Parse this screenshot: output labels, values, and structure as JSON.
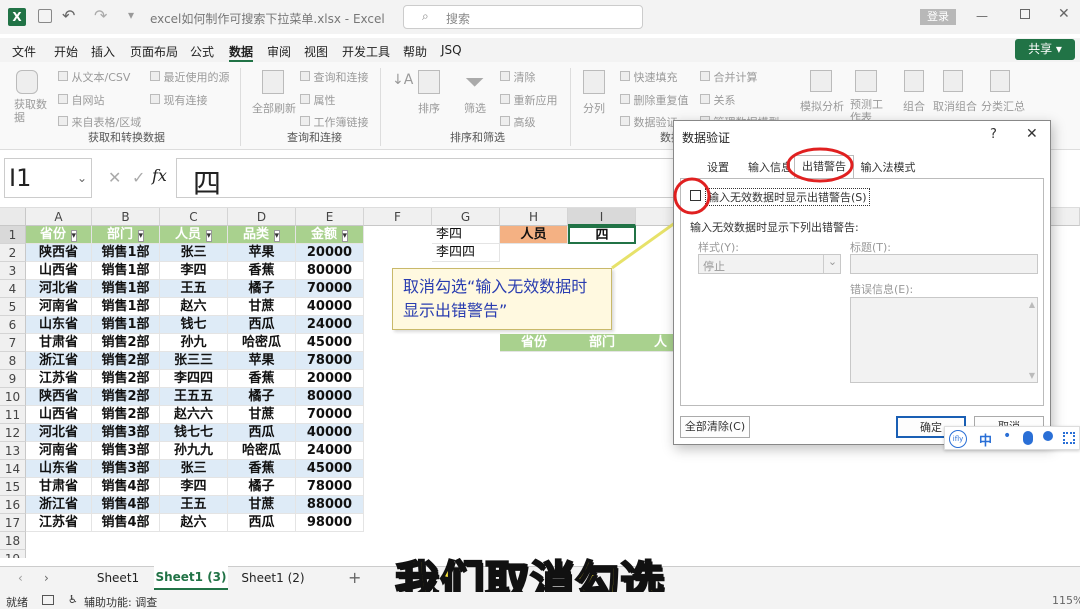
{
  "title": {
    "filename": "excel如何制作可搜索下拉菜单.xlsx - Excel",
    "search_placeholder": "搜索",
    "login": "登录"
  },
  "menu": {
    "items": [
      "文件",
      "开始",
      "插入",
      "页面布局",
      "公式",
      "数据",
      "审阅",
      "视图",
      "开发工具",
      "帮助",
      "JSQ"
    ],
    "share": "共享"
  },
  "ribbon": {
    "g1": {
      "big": "获取数据",
      "items": [
        "从文本/CSV",
        "自网站",
        "来自表格/区域",
        "最近使用的源",
        "现有连接"
      ],
      "label": "获取和转换数据"
    },
    "g2": {
      "big": "全部刷新",
      "items": [
        "查询和连接",
        "属性",
        "工作簿链接"
      ],
      "label": "查询和连接"
    },
    "g3": {
      "sort": "排序",
      "filter": "筛选",
      "items": [
        "清除",
        "重新应用",
        "高级"
      ],
      "label": "排序和筛选"
    },
    "g4": {
      "big": "分列",
      "items": [
        "快速填充",
        "删除重复值",
        "数据验证",
        "合并计算",
        "关系",
        "管理数据模型"
      ],
      "label": "数据"
    },
    "g5": {
      "items": [
        "模拟分析",
        "预测工作表"
      ]
    },
    "g6": {
      "items": [
        "组合",
        "取消组合",
        "分类汇总"
      ]
    }
  },
  "formula": {
    "namebox": "I1",
    "fx": "fx",
    "value": "四"
  },
  "grid": {
    "columns": [
      "A",
      "B",
      "C",
      "D",
      "E",
      "F",
      "G",
      "H",
      "I"
    ],
    "headers": [
      "省份",
      "部门",
      "人员",
      "品类",
      "金额"
    ],
    "rows": [
      [
        "陕西省",
        "销售1部",
        "张三",
        "苹果",
        "20000"
      ],
      [
        "山西省",
        "销售1部",
        "李四",
        "香蕉",
        "80000"
      ],
      [
        "河北省",
        "销售1部",
        "王五",
        "橘子",
        "70000"
      ],
      [
        "河南省",
        "销售1部",
        "赵六",
        "甘蔗",
        "40000"
      ],
      [
        "山东省",
        "销售1部",
        "钱七",
        "西瓜",
        "24000"
      ],
      [
        "甘肃省",
        "销售2部",
        "孙九",
        "哈密瓜",
        "45000"
      ],
      [
        "浙江省",
        "销售2部",
        "张三三",
        "苹果",
        "78000"
      ],
      [
        "江苏省",
        "销售2部",
        "李四四",
        "香蕉",
        "20000"
      ],
      [
        "陕西省",
        "销售2部",
        "王五五",
        "橘子",
        "80000"
      ],
      [
        "山西省",
        "销售2部",
        "赵六六",
        "甘蔗",
        "70000"
      ],
      [
        "河北省",
        "销售3部",
        "钱七七",
        "西瓜",
        "40000"
      ],
      [
        "河南省",
        "销售3部",
        "孙九九",
        "哈密瓜",
        "24000"
      ],
      [
        "山东省",
        "销售3部",
        "张三",
        "香蕉",
        "45000"
      ],
      [
        "甘肃省",
        "销售4部",
        "李四",
        "橘子",
        "78000"
      ],
      [
        "浙江省",
        "销售4部",
        "王五",
        "甘蔗",
        "88000"
      ],
      [
        "江苏省",
        "销售4部",
        "赵六",
        "西瓜",
        "98000"
      ]
    ],
    "rownums": [
      "1",
      "2",
      "3",
      "4",
      "5",
      "6",
      "7",
      "8",
      "9",
      "10",
      "11",
      "12",
      "13",
      "14",
      "15",
      "16",
      "17",
      "18",
      "19"
    ],
    "g1": "李四",
    "g2": "李四四",
    "h1": "人员",
    "i1": "四",
    "h7": [
      "省份",
      "部门",
      "人"
    ]
  },
  "callout": "取消勾选“输入无效数据时显示出错警告”",
  "subtitle": "我们取消勾选",
  "dialog": {
    "title": "数据验证",
    "help": "?",
    "tabs": [
      "设置",
      "输入信息",
      "出错警告",
      "输入法模式"
    ],
    "checkbox_label": "输入无效数据时显示出错警告(S)",
    "section": "输入无效数据时显示下列出错警告:",
    "style_label": "样式(Y):",
    "style_value": "停止",
    "title_label": "标题(T):",
    "msg_label": "错误信息(E):",
    "clear": "全部清除(C)",
    "ok": "确定",
    "cancel": "取消"
  },
  "ime": {
    "items": [
      "中",
      "•"
    ]
  },
  "sheets": [
    "Sheet1",
    "Sheet1 (3)",
    "Sheet1 (2)"
  ],
  "status": {
    "ready": "就绪",
    "accessibility": "辅助功能: 调查",
    "zoom": "115%"
  },
  "colors": {
    "excel_green": "#217346",
    "header_fill": "#a9d18e",
    "row_fill": "#deebf7",
    "highlight": "#f4b183",
    "callout_bg": "#fff9e0",
    "red": "#e02020"
  }
}
